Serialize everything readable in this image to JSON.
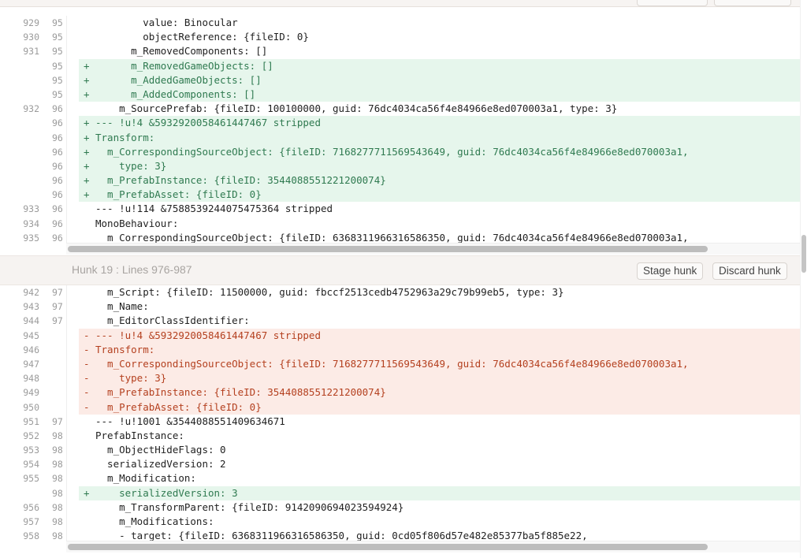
{
  "hunk18": {
    "rows": [
      {
        "old": "929",
        "new": "95",
        "type": "ctx",
        "text": "        value: Binocular"
      },
      {
        "old": "930",
        "new": "95",
        "type": "ctx",
        "text": "        objectReference: {fileID: 0}"
      },
      {
        "old": "931",
        "new": "95",
        "type": "ctx",
        "text": "      m_RemovedComponents: []"
      },
      {
        "old": "",
        "new": "95",
        "type": "add",
        "text": "      m_RemovedGameObjects: []"
      },
      {
        "old": "",
        "new": "95",
        "type": "add",
        "text": "      m_AddedGameObjects: []"
      },
      {
        "old": "",
        "new": "95",
        "type": "add",
        "text": "      m_AddedComponents: []"
      },
      {
        "old": "932",
        "new": "96",
        "type": "ctx",
        "text": "    m_SourcePrefab: {fileID: 100100000, guid: 76dc4034ca56f4e84966e8ed070003a1, type: 3}"
      },
      {
        "old": "",
        "new": "96",
        "type": "add",
        "text": "--- !u!4 &5932920058461447467 stripped"
      },
      {
        "old": "",
        "new": "96",
        "type": "add",
        "text": "Transform:"
      },
      {
        "old": "",
        "new": "96",
        "type": "add",
        "text": "  m_CorrespondingSourceObject: {fileID: 7168277711569543649, guid: 76dc4034ca56f4e84966e8ed070003a1,"
      },
      {
        "old": "",
        "new": "96",
        "type": "add",
        "text": "    type: 3}"
      },
      {
        "old": "",
        "new": "96",
        "type": "add",
        "text": "  m_PrefabInstance: {fileID: 3544088551221200074}"
      },
      {
        "old": "",
        "new": "96",
        "type": "add",
        "text": "  m_PrefabAsset: {fileID: 0}"
      },
      {
        "old": "933",
        "new": "96",
        "type": "ctx",
        "text": "--- !u!114 &7588539244075475364 stripped"
      },
      {
        "old": "934",
        "new": "96",
        "type": "ctx",
        "text": "MonoBehaviour:"
      },
      {
        "old": "935",
        "new": "96",
        "type": "ctx",
        "text": "  m_CorrespondingSourceObject: {fileID: 6368311966316586350, guid: 76dc4034ca56f4e84966e8ed070003a1,"
      }
    ]
  },
  "hunk19": {
    "title": "Hunk 19 : Lines 976-987",
    "stage_label": "Stage hunk",
    "discard_label": "Discard hunk",
    "rows": [
      {
        "old": "942",
        "new": "97",
        "type": "ctx",
        "text": "  m_Script: {fileID: 11500000, guid: fbccf2513cedb4752963a29c79b99eb5, type: 3}"
      },
      {
        "old": "943",
        "new": "97",
        "type": "ctx",
        "text": "  m_Name:"
      },
      {
        "old": "944",
        "new": "97",
        "type": "ctx",
        "text": "  m_EditorClassIdentifier:"
      },
      {
        "old": "945",
        "new": "",
        "type": "del",
        "text": "--- !u!4 &5932920058461447467 stripped"
      },
      {
        "old": "946",
        "new": "",
        "type": "del",
        "text": "Transform:"
      },
      {
        "old": "947",
        "new": "",
        "type": "del",
        "text": "  m_CorrespondingSourceObject: {fileID: 7168277711569543649, guid: 76dc4034ca56f4e84966e8ed070003a1,"
      },
      {
        "old": "948",
        "new": "",
        "type": "del",
        "text": "    type: 3}"
      },
      {
        "old": "949",
        "new": "",
        "type": "del",
        "text": "  m_PrefabInstance: {fileID: 3544088551221200074}"
      },
      {
        "old": "950",
        "new": "",
        "type": "del",
        "text": "  m_PrefabAsset: {fileID: 0}"
      },
      {
        "old": "951",
        "new": "97",
        "type": "ctx",
        "text": "--- !u!1001 &3544088551409634671"
      },
      {
        "old": "952",
        "new": "98",
        "type": "ctx",
        "text": "PrefabInstance:"
      },
      {
        "old": "953",
        "new": "98",
        "type": "ctx",
        "text": "  m_ObjectHideFlags: 0"
      },
      {
        "old": "954",
        "new": "98",
        "type": "ctx",
        "text": "  serializedVersion: 2"
      },
      {
        "old": "955",
        "new": "98",
        "type": "ctx",
        "text": "  m_Modification:"
      },
      {
        "old": "",
        "new": "98",
        "type": "add",
        "text": "    serializedVersion: 3"
      },
      {
        "old": "956",
        "new": "98",
        "type": "ctx",
        "text": "    m_TransformParent: {fileID: 9142090694023594924}"
      },
      {
        "old": "957",
        "new": "98",
        "type": "ctx",
        "text": "    m_Modifications:"
      },
      {
        "old": "958",
        "new": "98",
        "type": "ctx",
        "text": "    - target: {fileID: 6368311966316586350, guid: 0cd05f806d57e482e85377ba5f885e22,"
      }
    ]
  },
  "markers": {
    "add": "+",
    "del": "-",
    "ctx": ""
  },
  "colors": {
    "add_bg": "#e6f6ec",
    "del_bg": "#fcebe6",
    "add_text": "#2f7a50",
    "del_text": "#b4401f"
  }
}
